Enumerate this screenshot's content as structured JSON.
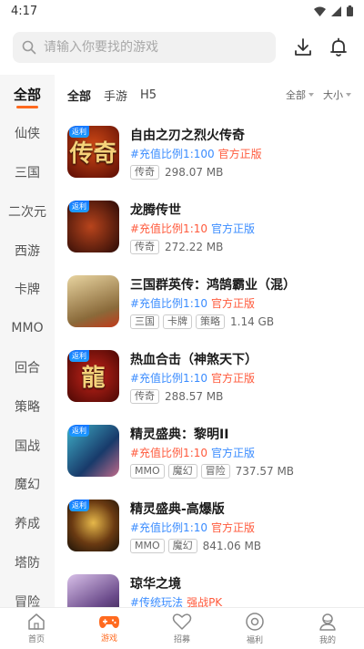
{
  "status_bar": {
    "time": "4:17"
  },
  "search": {
    "placeholder": "请输入你要找的游戏"
  },
  "sidebar": {
    "items": [
      {
        "label": "全部",
        "active": true
      },
      {
        "label": "仙侠"
      },
      {
        "label": "三国"
      },
      {
        "label": "二次元"
      },
      {
        "label": "西游"
      },
      {
        "label": "卡牌"
      },
      {
        "label": "MMO"
      },
      {
        "label": "回合"
      },
      {
        "label": "策略"
      },
      {
        "label": "国战"
      },
      {
        "label": "魔幻"
      },
      {
        "label": "养成"
      },
      {
        "label": "塔防"
      },
      {
        "label": "冒险"
      }
    ]
  },
  "filters": {
    "tabs": [
      {
        "label": "全部",
        "active": true
      },
      {
        "label": "手游"
      },
      {
        "label": "H5"
      }
    ],
    "sort_all": "全部",
    "sort_size": "大小"
  },
  "games": [
    {
      "name": "自由之刃之烈火传奇",
      "tag1": "#充值比例1:100",
      "tag1_color": "blue",
      "tag2": "官方正版",
      "meta_tags": [
        "传奇"
      ],
      "size": "298.07 MB",
      "badge": "返利",
      "icon_text": "传奇",
      "icon_bg": "#7a1408"
    },
    {
      "name": "龙腾传世",
      "tag1": "#充值比例1:10",
      "tag1_color": "red",
      "tag2": "官方正版",
      "meta_tags": [
        "传奇"
      ],
      "size": "272.22 MB",
      "badge": "返利",
      "icon_text": "",
      "icon_bg": "#4a1a12"
    },
    {
      "name": "三国群英传：鸿鹄霸业（混）",
      "tag1": "#充值比例1:10",
      "tag1_color": "blue",
      "tag2": "官方正版",
      "meta_tags": [
        "三国",
        "卡牌",
        "策略"
      ],
      "size": "1.14 GB",
      "badge": "",
      "icon_text": "",
      "icon_bg": "#c7a56a"
    },
    {
      "name": "热血合击（神煞天下）",
      "tag1": "#充值比例1:10",
      "tag1_color": "blue",
      "tag2": "官方正版",
      "meta_tags": [
        "传奇"
      ],
      "size": "288.57 MB",
      "badge": "返利",
      "icon_text": "龍",
      "icon_bg": "#8a1a0a"
    },
    {
      "name": "精灵盛典：黎明II",
      "tag1": "#充值比例1:10",
      "tag1_color": "red",
      "tag2": "官方正版",
      "meta_tags": [
        "MMO",
        "魔幻",
        "冒险"
      ],
      "size": "737.57 MB",
      "badge": "返利",
      "icon_text": "",
      "icon_bg": "#1d4f7a"
    },
    {
      "name": "精灵盛典-高爆版",
      "tag1": "#充值比例1:10",
      "tag1_color": "blue",
      "tag2": "官方正版",
      "meta_tags": [
        "MMO",
        "魔幻"
      ],
      "size": "841.06 MB",
      "badge": "返利",
      "icon_text": "",
      "icon_bg": "#5a3a1a"
    },
    {
      "name": "琼华之境",
      "tag1": "#传统玩法",
      "tag1_color": "blue",
      "tag2": "强战PK",
      "meta_tags": [],
      "size": "",
      "badge": "",
      "icon_text": "",
      "icon_bg": "#6a4a7a"
    }
  ],
  "bottom_nav": [
    {
      "label": "首页",
      "icon": "home-icon"
    },
    {
      "label": "游戏",
      "icon": "gamepad-icon",
      "active": true
    },
    {
      "label": "招募",
      "icon": "heart-icon"
    },
    {
      "label": "福利",
      "icon": "gift-circle-icon"
    },
    {
      "label": "我的",
      "icon": "user-icon"
    }
  ],
  "colors": {
    "accent": "#ff6a1f",
    "tag_blue": "#3a8cff",
    "tag_red": "#ff5a3c"
  }
}
